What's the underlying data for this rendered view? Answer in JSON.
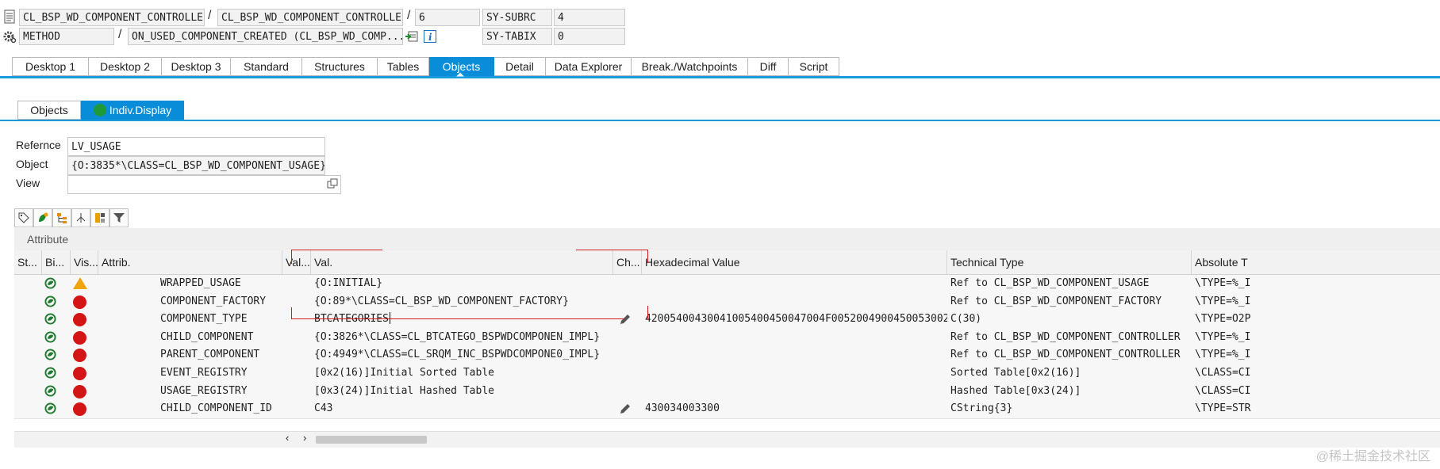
{
  "header": {
    "row1": {
      "program": "CL_BSP_WD_COMPONENT_CONTROLLE...",
      "include": "CL_BSP_WD_COMPONENT_CONTROLLE...",
      "line": "6",
      "sysvar1_name": "SY-SUBRC",
      "sysvar1_value": "4"
    },
    "row2": {
      "event_type": "METHOD",
      "event": "ON_USED_COMPONENT_CREATED (CL_BSP_WD_COMP...",
      "sysvar2_name": "SY-TABIX",
      "sysvar2_value": "0"
    },
    "separator": "/"
  },
  "tabs": [
    "Desktop 1",
    "Desktop 2",
    "Desktop 3",
    "Standard",
    "Structures",
    "Tables",
    "Objects",
    "Detail",
    "Data Explorer",
    "Break./Watchpoints",
    "Diff",
    "Script"
  ],
  "active_tab": "Objects",
  "subtabs": {
    "objects": "Objects",
    "indiv": "Indiv.Display"
  },
  "form": {
    "reference_label": "Refernce",
    "reference_value": "LV_USAGE",
    "object_label": "Object",
    "object_value": "{O:3835*\\CLASS=CL_BSP_WD_COMPONENT_USAGE}",
    "view_label": "View",
    "view_value": ""
  },
  "grid": {
    "section_label": "Attribute",
    "columns": [
      "St...",
      "Bi...",
      "Vis...",
      "Attrib.",
      "Val...",
      "Val.",
      "Ch...",
      "Hexadecimal Value",
      "Technical Type",
      "Absolute T"
    ],
    "rows": [
      {
        "attr": "WRAPPED_USAGE",
        "vis": "warning",
        "val": "{O:INITIAL}",
        "change": false,
        "hex": "",
        "type": "Ref to CL_BSP_WD_COMPONENT_USAGE",
        "abs": "\\TYPE=%_I"
      },
      {
        "attr": "COMPONENT_FACTORY",
        "vis": "private",
        "val": "{O:89*\\CLASS=CL_BSP_WD_COMPONENT_FACTORY}",
        "change": false,
        "hex": "",
        "type": "Ref to CL_BSP_WD_COMPONENT_FACTORY",
        "abs": "\\TYPE=%_I"
      },
      {
        "attr": "COMPONENT_TYPE",
        "vis": "private",
        "val": "BTCATEGORIES",
        "change": true,
        "hex": "42005400430041005400450047004F0052004900450053002...",
        "type": "C(30)",
        "abs": "\\TYPE=O2P"
      },
      {
        "attr": "CHILD_COMPONENT",
        "vis": "private",
        "val": "{O:3826*\\CLASS=CL_BTCATEGO_BSPWDCOMPONEN_IMPL}",
        "change": false,
        "hex": "",
        "type": "Ref to CL_BSP_WD_COMPONENT_CONTROLLER",
        "abs": "\\TYPE=%_I"
      },
      {
        "attr": "PARENT_COMPONENT",
        "vis": "private",
        "val": "{O:4949*\\CLASS=CL_SRQM_INC_BSPWDCOMPONE0_IMPL}",
        "change": false,
        "hex": "",
        "type": "Ref to CL_BSP_WD_COMPONENT_CONTROLLER",
        "abs": "\\TYPE=%_I"
      },
      {
        "attr": "EVENT_REGISTRY",
        "vis": "private",
        "val": "[0x2(16)]Initial Sorted Table",
        "change": false,
        "hex": "",
        "type": "Sorted Table[0x2(16)]",
        "abs": "\\CLASS=CI"
      },
      {
        "attr": "USAGE_REGISTRY",
        "vis": "private",
        "val": "[0x3(24)]Initial Hashed Table",
        "change": false,
        "hex": "",
        "type": "Hashed Table[0x3(24)]",
        "abs": "\\CLASS=CI"
      },
      {
        "attr": "CHILD_COMPONENT_ID",
        "vis": "private",
        "val": "C43",
        "change": true,
        "hex": "430034003300",
        "type": "CString{3}",
        "abs": "\\TYPE=STR"
      }
    ]
  },
  "watermark": "@稀土掘金技术社区",
  "colors": {
    "accent": "#0a8dd9",
    "private": "#d41515",
    "warning": "#f0a30a"
  }
}
